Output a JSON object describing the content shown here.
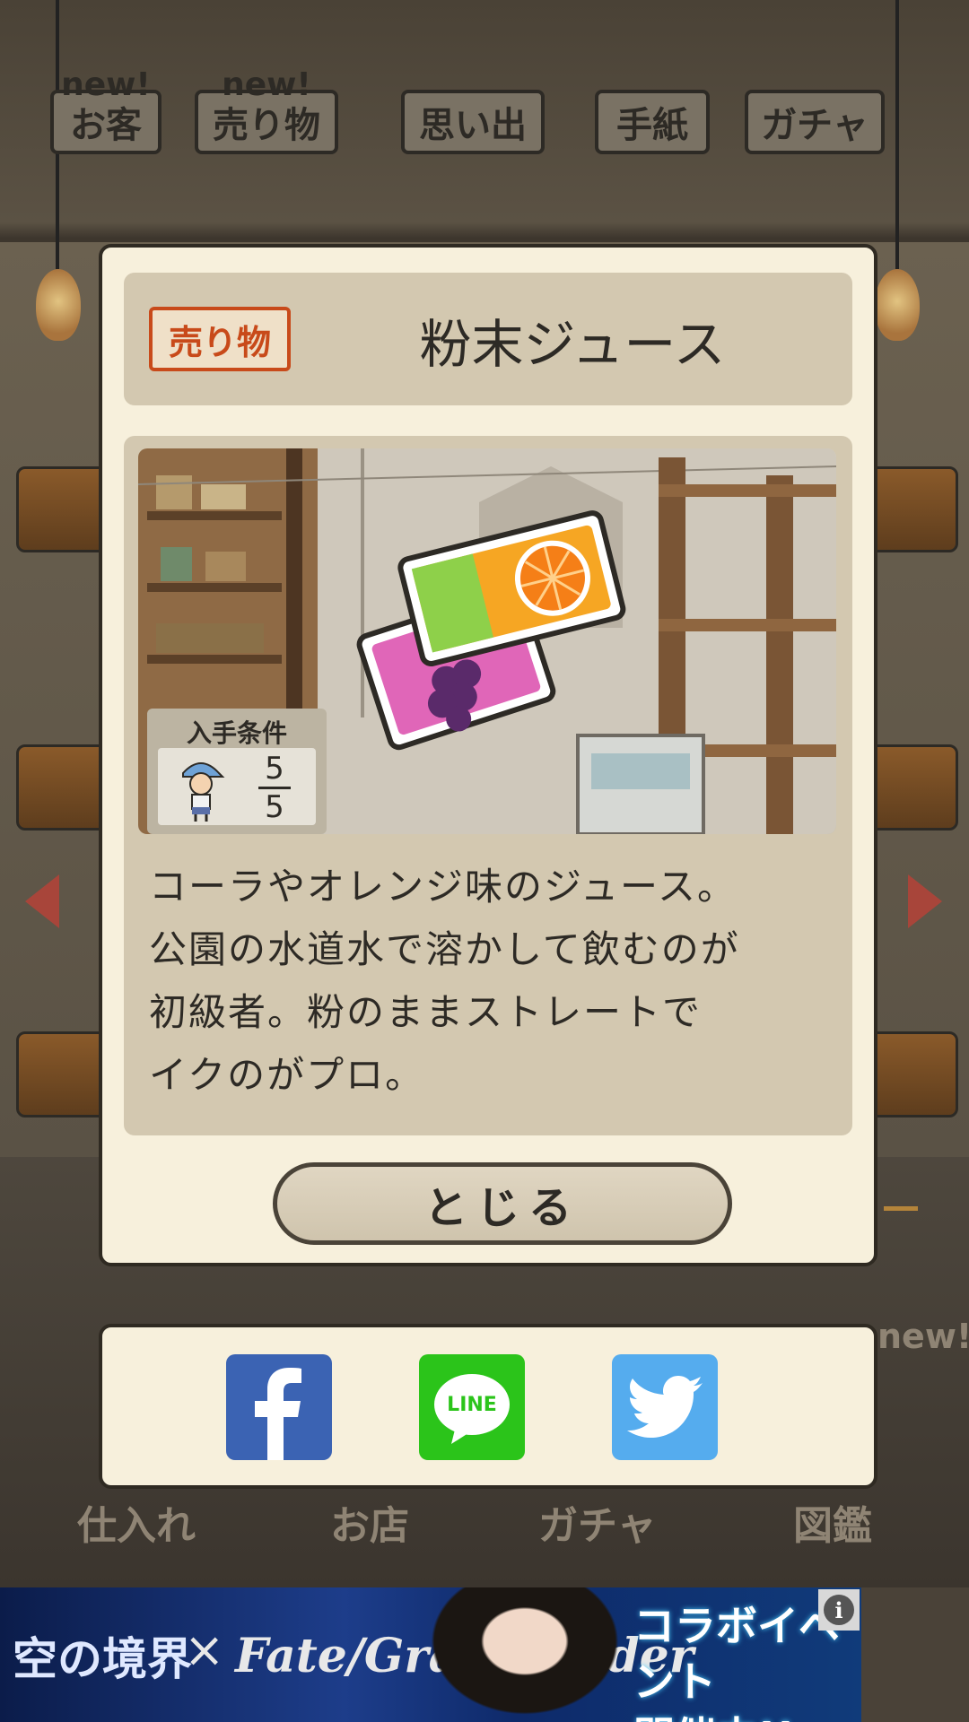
{
  "top_tabs": [
    {
      "label": "お客",
      "badge": "new!"
    },
    {
      "label": "売り物",
      "badge": "new!"
    },
    {
      "label": "思い出",
      "badge": ""
    },
    {
      "label": "手紙",
      "badge": ""
    },
    {
      "label": "ガチャ",
      "badge": ""
    }
  ],
  "modal": {
    "category": "売り物",
    "title": "粉末ジュース",
    "condition_label": "入手条件",
    "condition_numerator": "5",
    "condition_denominator": "5",
    "description_lines": [
      "コーラやオレンジ味のジュース。",
      "公園の水道水で溶かして飲むのが",
      "初級者。粉のままストレートで",
      "イクのがプロ。"
    ],
    "package_text": "オレンジ",
    "close_label": "とじる"
  },
  "share": {
    "line_label": "LINE"
  },
  "bottom_nav": {
    "items": [
      "仕入れ",
      "お店",
      "ガチャ",
      "図鑑"
    ],
    "right_badge": "new!"
  },
  "ad": {
    "left_text": "空の境界",
    "cross": "×",
    "brand": "Fate/Grand Order",
    "right_line1": "コラボイベント",
    "right_line2": "開催中!!",
    "info": "i"
  },
  "colors": {
    "accent_red": "#c84a1a",
    "panel": "#d3c8b0",
    "modal_bg": "#f7f0dc",
    "facebook": "#3b63b3",
    "line": "#2bc41a",
    "twitter": "#55acee"
  }
}
